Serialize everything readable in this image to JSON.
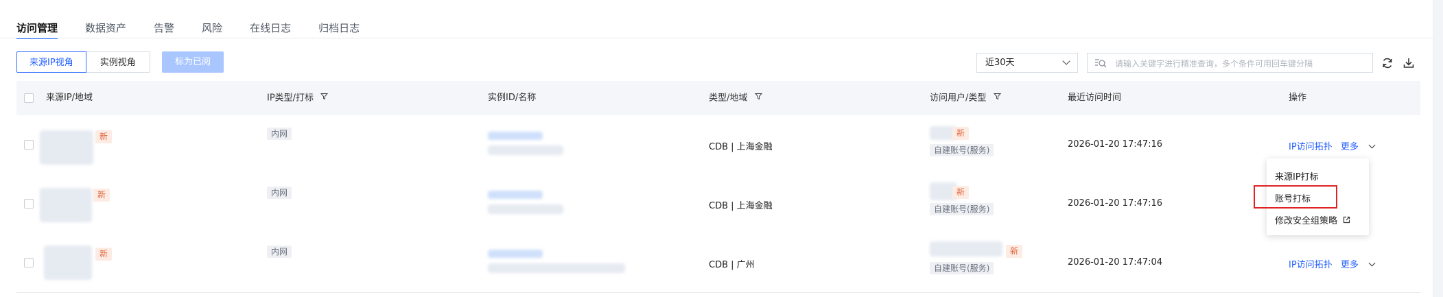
{
  "tabs": [
    "访问管理",
    "数据资产",
    "告警",
    "风险",
    "在线日志",
    "归档日志"
  ],
  "toolbar": {
    "view_source_ip": "来源IP视角",
    "view_instance": "实例视角",
    "mark_read": "标为已阅",
    "date_range": "近30天",
    "search_placeholder": "请输入关键字进行精准查询，多个条件可用回车键分隔"
  },
  "columns": {
    "source_ip": "来源IP/地域",
    "ip_type": "IP类型/打标",
    "instance": "实例ID/名称",
    "type_region": "类型/地域",
    "user_type": "访问用户/类型",
    "last_time": "最近访问时间",
    "actions": "操作"
  },
  "rows": [
    {
      "badge": "新",
      "ip_tag": "内网",
      "type_region": "CDB | 上海金融",
      "user_badge": "新",
      "user_type": "自建账号(服务)",
      "time": "2026-01-20 17:47:16",
      "action_topology": "IP访问拓扑",
      "action_more": "更多"
    },
    {
      "badge": "新",
      "ip_tag": "内网",
      "type_region": "CDB | 上海金融",
      "user_badge": "新",
      "user_type": "自建账号(服务)",
      "time": "2026-01-20 17:47:16"
    },
    {
      "badge": "新",
      "ip_tag": "内网",
      "type_region": "CDB | 广州",
      "user_badge": "新",
      "user_type": "自建账号(服务)",
      "time": "2026-01-20 17:47:04",
      "action_topology": "IP访问拓扑",
      "action_more": "更多"
    }
  ],
  "dropdown": {
    "items": [
      "来源IP打标",
      "账号打标",
      "修改安全组策略"
    ],
    "highlighted": "账号打标"
  },
  "colors": {
    "accent": "#1f5cff",
    "badge_new": "#e0643c",
    "highlight_box": "#e02222"
  }
}
